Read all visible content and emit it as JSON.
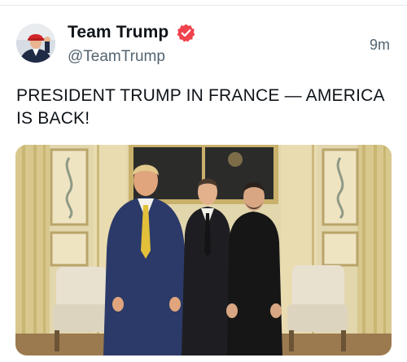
{
  "post": {
    "author": {
      "display_name": "Team Trump",
      "handle": "@TeamTrump",
      "verified": true,
      "verified_icon": "verified-badge-icon"
    },
    "timestamp": "9m",
    "text": "PRESIDENT TRUMP IN FRANCE — AMERICA IS BACK!",
    "media": {
      "type": "photo",
      "alt": ""
    }
  },
  "colors": {
    "text_primary": "#0f1419",
    "text_secondary": "#536471",
    "verified_badge": "#f0434d",
    "divider": "#e6e8ea"
  }
}
